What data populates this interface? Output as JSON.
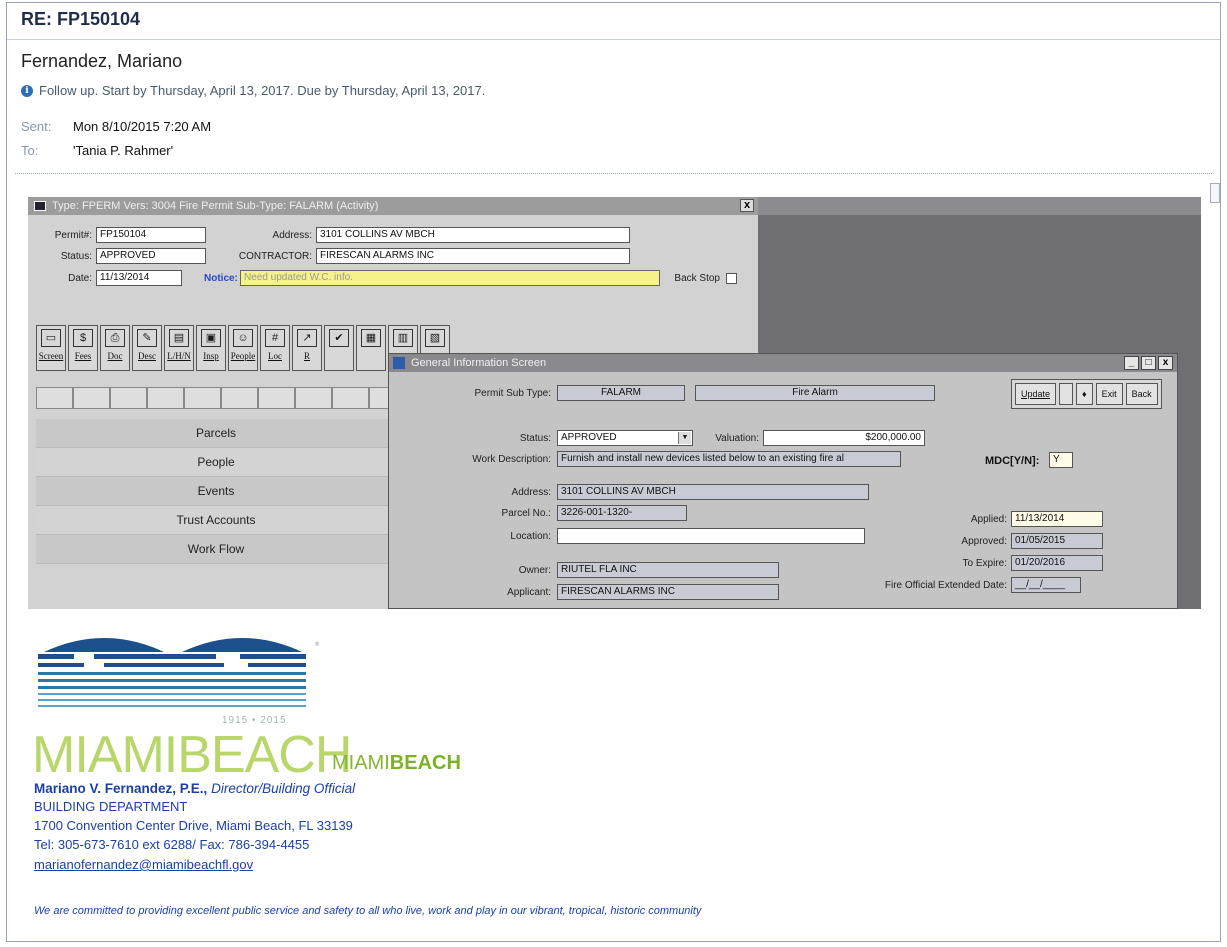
{
  "email": {
    "subject": "RE: FP150104",
    "sender": "Fernandez, Mariano",
    "followup": "Follow up.  Start by Thursday, April 13, 2017.  Due by Thursday, April 13, 2017.",
    "sent_label": "Sent:",
    "sent_value": "Mon 8/10/2015 7:20 AM",
    "to_label": "To:",
    "to_value": "'Tania P. Rahmer'"
  },
  "permit_window": {
    "title": "Type: FPERM Vers: 3004 Fire Permit Sub-Type: FALARM (Activity)",
    "close": "x",
    "permit_label": "Permit#:",
    "permit_value": "FP150104",
    "address_label": "Address:",
    "address_value": "3101 COLLINS AV  MBCH",
    "status_label": "Status:",
    "status_value": "APPROVED",
    "contractor_label": "CONTRACTOR:",
    "contractor_value": "FIRESCAN ALARMS INC",
    "date_label": "Date:",
    "date_value": "11/13/2014",
    "notice_label": "Notice:",
    "notice_value": "Need updated W.C. info.",
    "backstop_label": "Back Stop",
    "toolbar": [
      {
        "label": "Screen",
        "icon": "screen-icon",
        "glyph": "▭"
      },
      {
        "label": "Fees",
        "icon": "dollar-icon",
        "glyph": "$"
      },
      {
        "label": "Doc",
        "icon": "printer-icon",
        "glyph": "⎙"
      },
      {
        "label": "Desc",
        "icon": "notepad-icon",
        "glyph": "✎"
      },
      {
        "label": "L/H/N",
        "icon": "folder-icon",
        "glyph": "▤"
      },
      {
        "label": "Insp",
        "icon": "clipboard-icon",
        "glyph": "▣"
      },
      {
        "label": "People",
        "icon": "people-icon",
        "glyph": "☺"
      },
      {
        "label": "Loc",
        "icon": "grid-icon",
        "glyph": "#"
      },
      {
        "label": "R",
        "icon": "route-icon",
        "glyph": "↗"
      },
      {
        "label": "",
        "icon": "check-icon",
        "glyph": "✔"
      },
      {
        "label": "",
        "icon": "calendar-icon",
        "glyph": "▦"
      },
      {
        "label": "",
        "icon": "cabinet-icon",
        "glyph": "▥"
      },
      {
        "label": "",
        "icon": "document-icon",
        "glyph": "▧"
      }
    ],
    "nav": [
      "Parcels",
      "People",
      "Events",
      "Trust Accounts",
      "Work Flow"
    ]
  },
  "general_window": {
    "title": "General Information Screen",
    "minimize": "_",
    "maximize": "□",
    "close": "x",
    "subtype_label": "Permit Sub Type:",
    "subtype_code": "FALARM",
    "subtype_desc": "Fire Alarm",
    "buttons": [
      "Update",
      "",
      "♦",
      "Exit",
      "Back"
    ],
    "status_label": "Status:",
    "status_value": "APPROVED",
    "valuation_label": "Valuation:",
    "valuation_value": "$200,000.00",
    "workdesc_label": "Work Description:",
    "workdesc_value": "Furnish and install new devices listed below to an existing fire al",
    "mdc_label": "MDC[Y/N]:",
    "mdc_value": "Y",
    "address_label": "Address:",
    "address_value": "3101 COLLINS AV  MBCH",
    "parcel_label": "Parcel No.:",
    "parcel_value": "3226-001-1320-",
    "location_label": "Location:",
    "location_value": "",
    "owner_label": "Owner:",
    "owner_value": "RIUTEL FLA INC",
    "applicant_label": "Applicant:",
    "applicant_value": "FIRESCAN ALARMS INC",
    "applied_label": "Applied:",
    "applied_value": "11/13/2014",
    "approved_label": "Approved:",
    "approved_value": "01/05/2015",
    "expire_label": "To Expire:",
    "expire_value": "01/20/2016",
    "extended_label": "Fire Official Extended Date:",
    "extended_value": "__/__/____"
  },
  "signature": {
    "logo_years": "1915 • 2015",
    "logo_word": "MIAMIBEACH",
    "brand_light": "MIAMI",
    "brand_bold": "BEACH",
    "name": "Mariano V. Fernandez, P.E.,",
    "title": "Director/Building Official",
    "dept": "BUILDING DEPARTMENT",
    "address": "1700 Convention Center Drive, Miami Beach, FL 33139",
    "phone": "Tel: 305-673-7610 ext 6288/ Fax: 786-394-4455",
    "email": "marianofernandez@miamibeachfl.gov",
    "motto": "We are committed to providing excellent public service and safety to all who live, work and play in our vibrant, tropical, historic community"
  },
  "colors": {
    "subject": "#1f2f4a",
    "signature_blue": "#1b3fa6",
    "brand_green": "#7cb228",
    "notice_yellow": "#f5f28a",
    "logo_blue": "#1c4f8c"
  }
}
